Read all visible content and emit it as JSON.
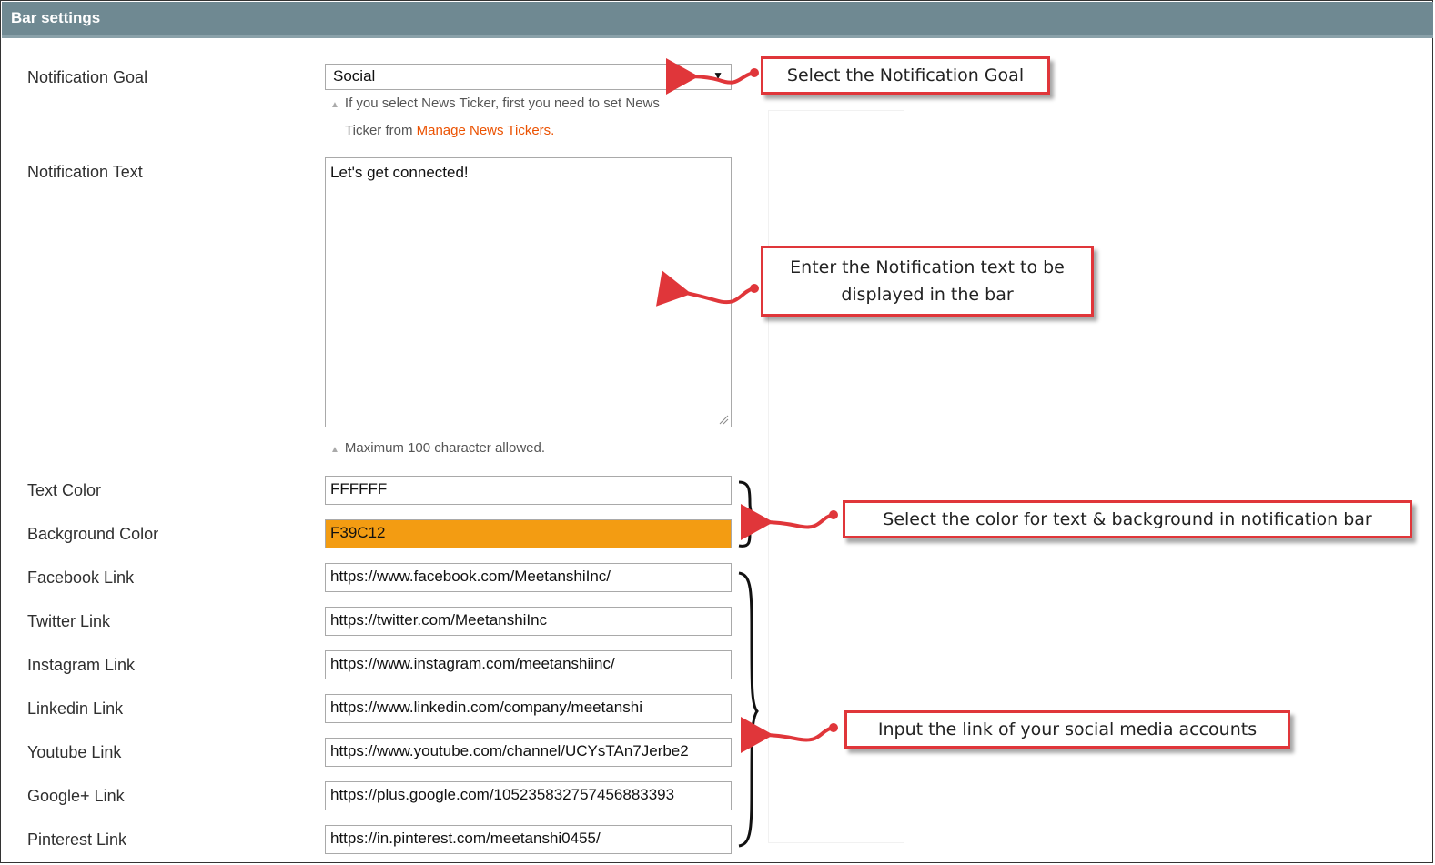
{
  "section": {
    "title": "Bar settings"
  },
  "fields": {
    "notification_goal": {
      "label": "Notification Goal",
      "value": "Social",
      "note_line1": "If you select News Ticker, first you need to set News",
      "note_line2_prefix": "Ticker from",
      "note_link": "Manage News Tickers."
    },
    "notification_text": {
      "label": "Notification Text",
      "value": "Let's get connected!",
      "note": "Maximum 100 character allowed."
    },
    "text_color": {
      "label": "Text Color",
      "value": "FFFFFF"
    },
    "background_color": {
      "label": "Background Color",
      "value": "F39C12",
      "swatch": "#f39c12"
    },
    "facebook": {
      "label": "Facebook Link",
      "value": "https://www.facebook.com/MeetanshiInc/"
    },
    "twitter": {
      "label": "Twitter Link",
      "value": "https://twitter.com/MeetanshiInc"
    },
    "instagram": {
      "label": "Instagram Link",
      "value": "https://www.instagram.com/meetanshiinc/"
    },
    "linkedin": {
      "label": "Linkedin Link",
      "value": "https://www.linkedin.com/company/meetanshi"
    },
    "youtube": {
      "label": "Youtube Link",
      "value": "https://www.youtube.com/channel/UCYsTAn7Jerbe2"
    },
    "googleplus": {
      "label": "Google+ Link",
      "value": "https://plus.google.com/105235832757456883393"
    },
    "pinterest": {
      "label": "Pinterest Link",
      "value": "https://in.pinterest.com/meetanshi0455/"
    }
  },
  "callouts": {
    "goal": "Select the Notification Goal",
    "text_line1": "Enter the Notification text to be",
    "text_line2": "displayed in the bar",
    "colors": "Select the color for text & background in notification bar",
    "social": "Input the link of your social media accounts"
  },
  "colors": {
    "header": "#6f8992",
    "callout_border": "#e0363a",
    "link": "#eb5202"
  }
}
